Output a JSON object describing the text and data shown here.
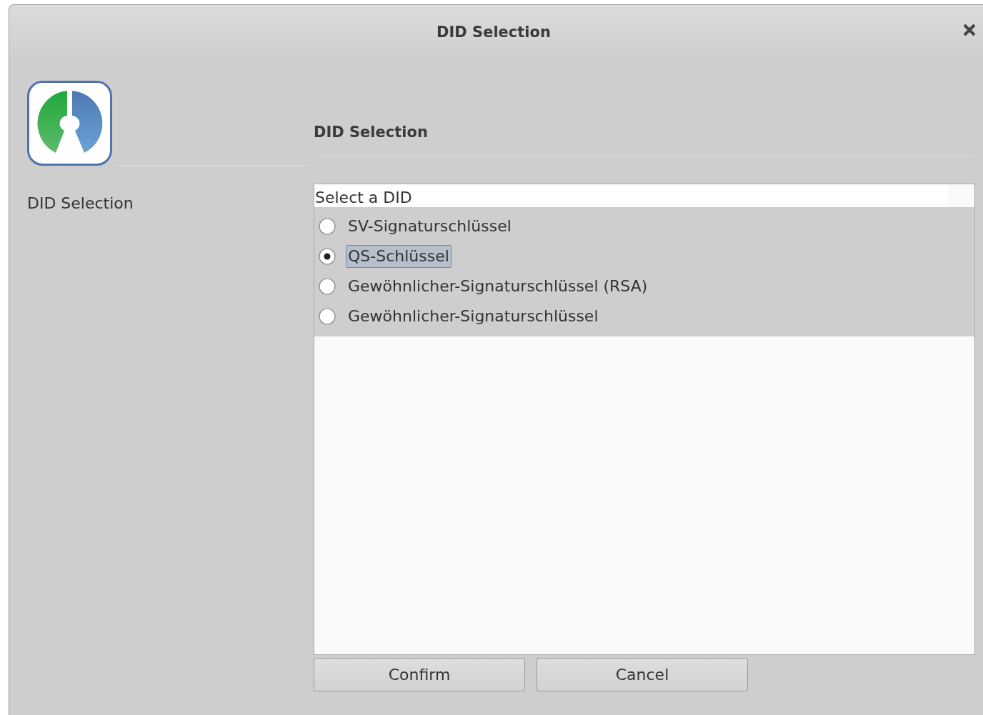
{
  "window": {
    "title": "DID Selection"
  },
  "sidebar": {
    "step": "DID Selection"
  },
  "header": {
    "title": "DID Selection"
  },
  "selection": {
    "label": "Select a DID",
    "options": [
      {
        "label": "SV-Signaturschlüssel",
        "selected": false
      },
      {
        "label": "QS-Schlüssel",
        "selected": true
      },
      {
        "label": "Gewöhnlicher-Signaturschlüssel (RSA)",
        "selected": false
      },
      {
        "label": "Gewöhnlicher-Signaturschlüssel",
        "selected": false
      }
    ]
  },
  "buttons": [
    {
      "label": "Confirm"
    },
    {
      "label": "Cancel"
    }
  ]
}
